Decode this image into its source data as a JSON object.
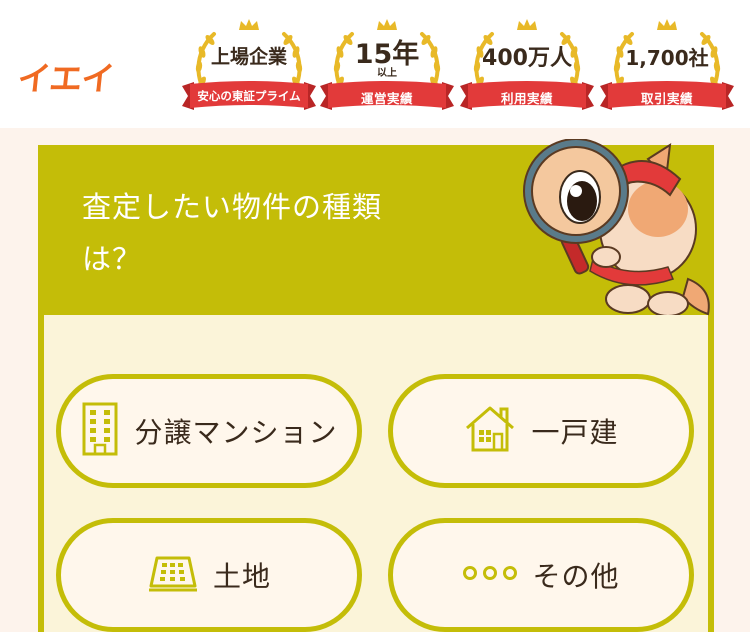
{
  "header": {
    "logo_text": "イエイ",
    "badges": [
      {
        "main": "上場企業",
        "sub": "",
        "ribbon": "安心の東証プライム"
      },
      {
        "main": "15年",
        "sub": "以上",
        "ribbon": "運営実績"
      },
      {
        "main": "400万人",
        "sub": "",
        "ribbon": "利用実績"
      },
      {
        "main": "1,700社",
        "sub": "",
        "ribbon": "取引実績"
      }
    ]
  },
  "main": {
    "title_line1": "査定したい物件の種類",
    "title_line2": "は？",
    "options": [
      {
        "label": "分譲マンション",
        "icon": "building-icon"
      },
      {
        "label": "一戸建",
        "icon": "house-icon"
      },
      {
        "label": "土地",
        "icon": "land-icon"
      },
      {
        "label": "その他",
        "icon": "dots-icon"
      }
    ]
  },
  "colors": {
    "brand_orange": "#f06a22",
    "olive": "#c4bd08",
    "ribbon_red": "#e23a3a",
    "gold": "#e8b928",
    "panel_bg": "#fbf4d9",
    "page_bg": "#fdf3ec"
  }
}
